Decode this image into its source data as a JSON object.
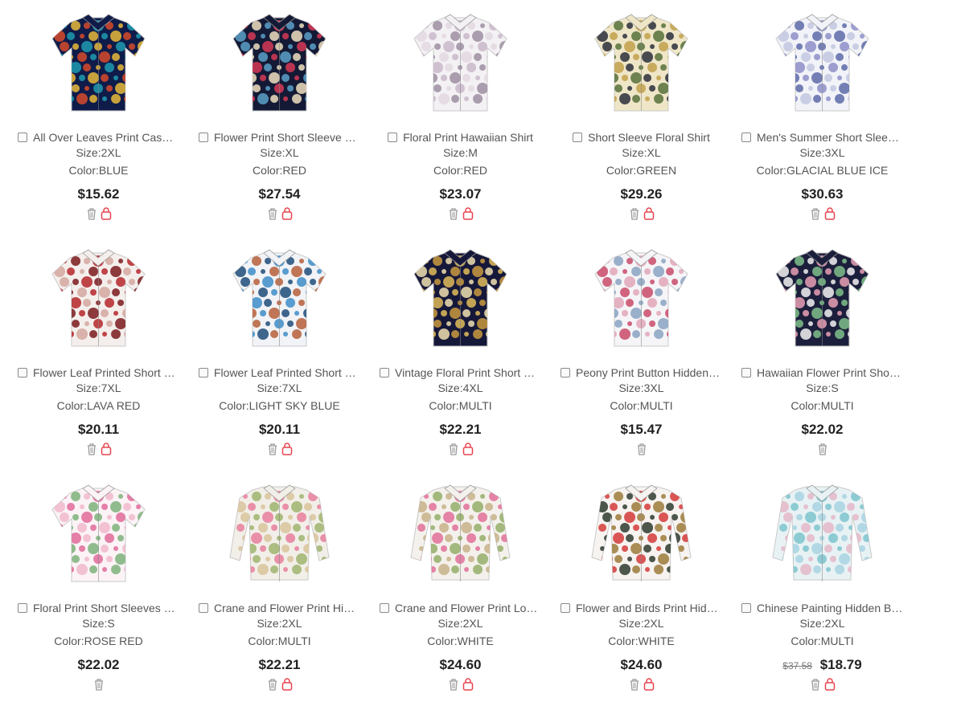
{
  "colors": {
    "text": "#555555",
    "price": "#222222",
    "bag_icon": "#e8434f",
    "trash_icon": "#999999"
  },
  "products": [
    {
      "title": "All Over Leaves Print Casual Shirt",
      "size": "Size:2XL",
      "color": "Color:BLUE",
      "price": "$15.62",
      "old_price": "",
      "bag": true,
      "palette": [
        "#0f1c4a",
        "#1f9ab0",
        "#e8b93a",
        "#d64a2a"
      ]
    },
    {
      "title": "Flower Print Short Sleeve Shirt",
      "size": "Size:XL",
      "color": "Color:RED",
      "price": "$27.54",
      "old_price": "",
      "bag": true,
      "palette": [
        "#141a35",
        "#d63a55",
        "#efe0c0",
        "#5ba0c8"
      ]
    },
    {
      "title": "Floral Print Hawaiian Shirt",
      "size": "Size:M",
      "color": "Color:RED",
      "price": "$23.07",
      "old_price": "",
      "bag": true,
      "palette": [
        "#f4f1f4",
        "#c9b9c9",
        "#9c8ea0",
        "#e2d8e0"
      ]
    },
    {
      "title": "Short Sleeve Floral Shirt",
      "size": "Size:XL",
      "color": "Color:GREEN",
      "price": "$29.26",
      "old_price": "",
      "bag": true,
      "palette": [
        "#efe6c8",
        "#c2a04a",
        "#56703a",
        "#2a2e3a"
      ]
    },
    {
      "title": "Men's Summer Short Sleeve Shirt",
      "size": "Size:3XL",
      "color": "Color:GLACIAL BLUE ICE",
      "price": "$30.63",
      "old_price": "",
      "bag": true,
      "palette": [
        "#f2f3f8",
        "#8e8ec8",
        "#5d6aa8",
        "#c3c7e0"
      ]
    },
    {
      "title": "Flower Leaf Printed Short Sleeve Shirt",
      "size": "Size:7XL",
      "color": "Color:LAVA RED",
      "price": "$20.11",
      "old_price": "",
      "bag": true,
      "palette": [
        "#f4efec",
        "#b5262c",
        "#7a1a1e",
        "#d4a7a0"
      ]
    },
    {
      "title": "Flower Leaf Printed Short Sleeve Shirt",
      "size": "Size:7XL",
      "color": "Color:LIGHT SKY BLUE",
      "price": "$20.11",
      "old_price": "",
      "bag": true,
      "palette": [
        "#f1f3f6",
        "#3e8cc8",
        "#b65e3a",
        "#1f4c7a"
      ]
    },
    {
      "title": "Vintage Floral Print Short Sleeve Shirt",
      "size": "Size:4XL",
      "color": "Color:MULTI",
      "price": "$22.21",
      "old_price": "",
      "bag": true,
      "palette": [
        "#16183a",
        "#e0bc5a",
        "#c99a40",
        "#f0e0b0"
      ]
    },
    {
      "title": "Peony Print Button Hidden Shirt",
      "size": "Size:3XL",
      "color": "Color:MULTI",
      "price": "$15.47",
      "old_price": "",
      "bag": false,
      "palette": [
        "#f5f5f8",
        "#e2a6b8",
        "#8aa3c2",
        "#c94a6a"
      ]
    },
    {
      "title": "Hawaiian Flower Print Short Sleeve Shirt",
      "size": "Size:S",
      "color": "Color:MULTI",
      "price": "$22.02",
      "old_price": "",
      "bag": false,
      "palette": [
        "#1c1f3c",
        "#e9a0b4",
        "#7fc08a",
        "#f2f2f2"
      ]
    },
    {
      "title": "Floral Print Short Sleeves Shirt",
      "size": "Size:S",
      "color": "Color:ROSE RED",
      "price": "$22.02",
      "old_price": "",
      "bag": false,
      "palette": [
        "#fbf3f6",
        "#e06a9a",
        "#7cb27a",
        "#f0b8cc"
      ]
    },
    {
      "title": "Crane and Flower Print Hidden Button Shirt",
      "size": "Size:2XL",
      "color": "Color:MULTI",
      "price": "$22.21",
      "old_price": "",
      "bag": true,
      "palette": [
        "#f2efe9",
        "#e77f9c",
        "#9fb46d",
        "#d9c39a"
      ]
    },
    {
      "title": "Crane and Flower Print Long Sleeve Shirt",
      "size": "Size:2XL",
      "color": "Color:WHITE",
      "price": "$24.60",
      "old_price": "",
      "bag": true,
      "palette": [
        "#f4f1ec",
        "#e0709a",
        "#94ae68",
        "#c7b28a"
      ]
    },
    {
      "title": "Flower and Birds Print Hidden Button Shirt",
      "size": "Size:2XL",
      "color": "Color:WHITE",
      "price": "$24.60",
      "old_price": "",
      "bag": true,
      "palette": [
        "#f6f3f0",
        "#d43a3a",
        "#9c7a3a",
        "#2e3a2e"
      ]
    },
    {
      "title": "Chinese Painting Hidden Button Shirt",
      "size": "Size:2XL",
      "color": "Color:MULTI",
      "price": "$18.79",
      "old_price": "$37.58",
      "bag": true,
      "palette": [
        "#e8f2f4",
        "#7cc4cc",
        "#a7d3e0",
        "#e4b8c8"
      ]
    }
  ]
}
